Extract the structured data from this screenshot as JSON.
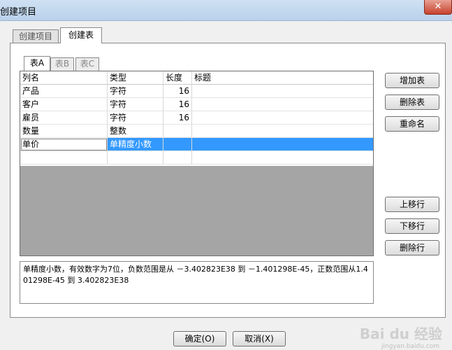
{
  "window": {
    "title": "创建项目",
    "close_glyph": "✕"
  },
  "outer_tabs": [
    {
      "label": "创建项目"
    },
    {
      "label": "创建表"
    }
  ],
  "inner_tabs": [
    {
      "label": "表A"
    },
    {
      "label": "表B"
    },
    {
      "label": "表C"
    }
  ],
  "grid": {
    "headers": [
      "列名",
      "类型",
      "长度",
      "标题"
    ],
    "rows": [
      [
        "产品",
        "字符",
        "16",
        ""
      ],
      [
        "客户",
        "字符",
        "16",
        ""
      ],
      [
        "雇员",
        "字符",
        "16",
        ""
      ],
      [
        "数量",
        "整数",
        "",
        ""
      ],
      [
        "单价",
        "单精度小数",
        "",
        ""
      ],
      [
        "",
        "",
        "",
        ""
      ]
    ]
  },
  "side_buttons": {
    "add_table": "增加表",
    "delete_table": "删除表",
    "rename": "重命名",
    "move_up": "上移行",
    "move_down": "下移行",
    "delete_row": "删除行"
  },
  "description": "单精度小数，有效数字为7位，负数范围是从 －3.402823E38 到 －1.401298E-45，正数范围从1.401298E-45 到 3.402823E38",
  "bottom_buttons": {
    "ok": "确定(O)",
    "cancel": "取消(X)"
  },
  "watermark": {
    "brand": "Bai du 经验",
    "url": "jingyan.baidu.com"
  }
}
